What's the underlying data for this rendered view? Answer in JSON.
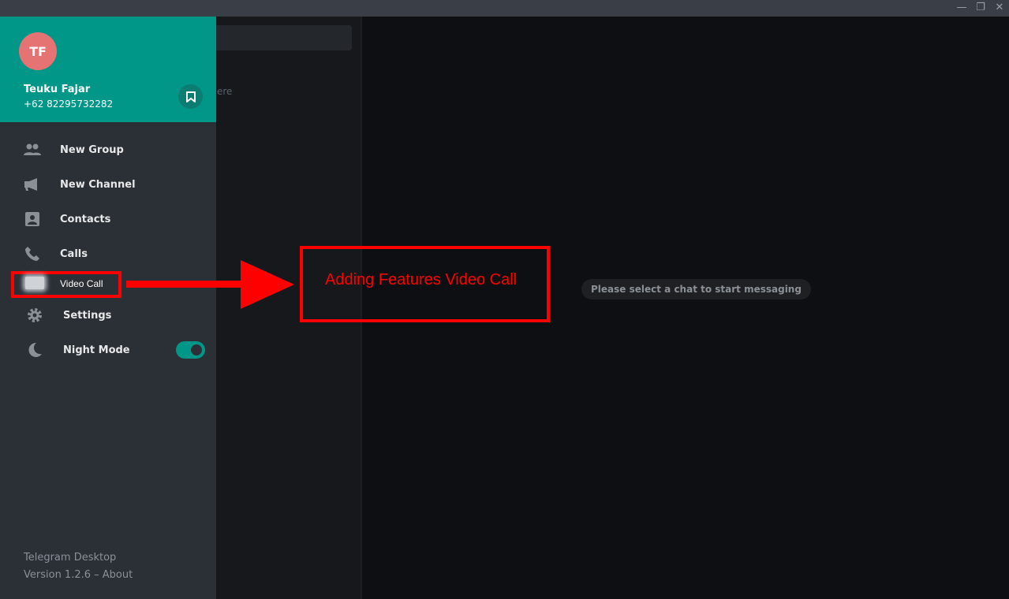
{
  "window": {
    "minimize": "—",
    "maximize": "❐",
    "close": "✕"
  },
  "chat_list": {
    "hint_fragment": "ere"
  },
  "profile": {
    "initials": "TF",
    "name": "Teuku Fajar",
    "phone": "+62 82295732282",
    "avatar_color": "#e57373",
    "header_color": "#009688"
  },
  "menu": [
    {
      "label": "New Group",
      "icon": "group-icon"
    },
    {
      "label": "New Channel",
      "icon": "megaphone-icon"
    },
    {
      "label": "Contacts",
      "icon": "contact-icon"
    },
    {
      "label": "Calls",
      "icon": "phone-icon"
    },
    {
      "label": "Video Call",
      "icon": "video-icon"
    },
    {
      "label": "Settings",
      "icon": "gear-icon"
    },
    {
      "label": "Night Mode",
      "icon": "moon-icon",
      "toggle": true
    }
  ],
  "footer": {
    "app": "Telegram Desktop",
    "version": "Version 1.2.6 – About"
  },
  "annotation": {
    "text": "Adding Features Video Call",
    "color": "#ff0000"
  },
  "main": {
    "empty_message": "Please select a chat to start messaging"
  }
}
